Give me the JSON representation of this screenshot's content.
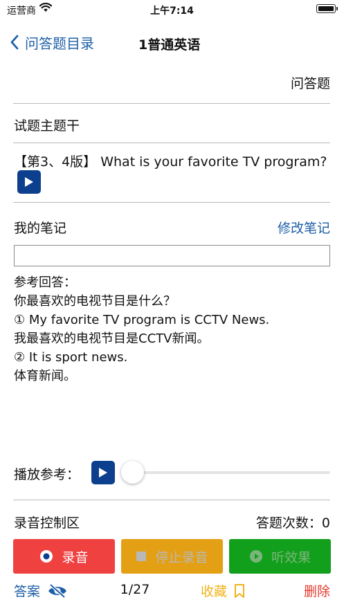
{
  "status_bar": {
    "carrier": "运营商",
    "time": "上午7:14"
  },
  "nav": {
    "back_label": "问答题目录",
    "title": "1普通英语"
  },
  "question_type": "问答题",
  "stem_label": "试题主题干",
  "question": {
    "text": "【第3、4版】 What is your favorite TV program?"
  },
  "notes": {
    "label": "我的笔记",
    "edit_label": "修改笔记",
    "value": ""
  },
  "reference_answer": {
    "lines": [
      "参考回答：",
      "你最喜欢的电视节目是什么？",
      "① My favorite TV program is CCTV News.",
      "我最喜欢的电视节目是CCTV新闻。",
      "② It is sport news.",
      "体育新闻。"
    ]
  },
  "playback": {
    "label": "播放参考：",
    "progress": 0
  },
  "recording": {
    "area_label": "录音控制区",
    "count_label": "答题次数：0"
  },
  "buttons": {
    "record": "录音",
    "stop": "停止录音",
    "listen": "听效果"
  },
  "bottom": {
    "answer": "答案",
    "page": "1/27",
    "favorite": "收藏",
    "delete": "删除"
  },
  "colors": {
    "accent": "#1e5fa8",
    "play_button": "#0d3f8f",
    "record": "#f04141",
    "stop": "#e3a015",
    "listen": "#12a01c",
    "favorite": "#f0b31a",
    "delete": "#e23a2c"
  }
}
